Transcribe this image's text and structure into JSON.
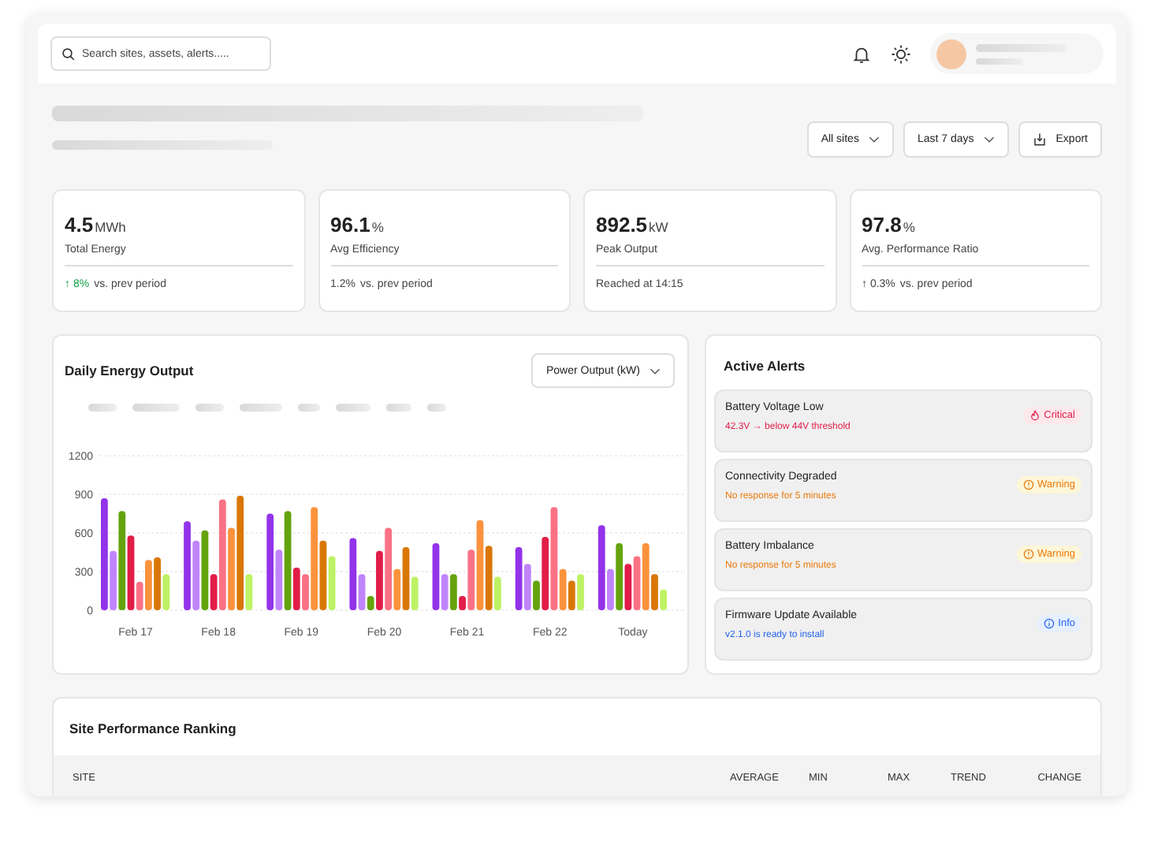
{
  "header": {
    "search": {
      "placeholder": "Search sites, assets, alerts....."
    }
  },
  "toolbar": {
    "filters": [
      {
        "label": "All sites"
      },
      {
        "label": "Last 7 days"
      }
    ],
    "export": "Export"
  },
  "kpis": [
    {
      "value": "4.5",
      "unit": "MWh",
      "label": "Total Energy",
      "delta": "↑ 8%",
      "highlight": true,
      "note": "vs. prev period"
    },
    {
      "value": "96.1",
      "unit": "%",
      "label": "Avg Efficiency",
      "delta": "1.2%",
      "highlight": false,
      "note": "vs. prev period"
    },
    {
      "value": "892.5",
      "unit": "kW",
      "label": "Peak Output",
      "note": "Reached at 14:15"
    },
    {
      "value": "97.8",
      "unit": "%",
      "label": "Avg. Performance Ratio",
      "delta": "↑ 0.3%",
      "highlight": false,
      "note": "vs. prev period"
    }
  ],
  "energy_chart": {
    "title": "Daily Energy Output",
    "metric": "Power Output (kW)",
    "chart_data": {
      "type": "bar",
      "categories": [
        "Feb 17",
        "Feb 18",
        "Feb 19",
        "Feb 20",
        "Feb 21",
        "Feb 22",
        "Today"
      ],
      "ylim": [
        0,
        1200
      ],
      "grid": true,
      "yticks": [
        0,
        300,
        600,
        900,
        1200
      ],
      "series": [
        {
          "color": "#9333ea",
          "values": [
            870,
            690,
            750,
            560,
            520,
            490,
            660
          ]
        },
        {
          "color": "#c084fc",
          "values": [
            460,
            540,
            470,
            280,
            280,
            360,
            320
          ]
        },
        {
          "color": "#65a30d",
          "values": [
            770,
            620,
            770,
            110,
            280,
            230,
            520
          ]
        },
        {
          "color": "#e11d48",
          "values": [
            580,
            280,
            330,
            460,
            110,
            570,
            360
          ]
        },
        {
          "color": "#fb7185",
          "values": [
            220,
            860,
            280,
            640,
            470,
            800,
            420
          ]
        },
        {
          "color": "#fb923c",
          "values": [
            390,
            640,
            800,
            320,
            700,
            320,
            520
          ]
        },
        {
          "color": "#d97706",
          "values": [
            410,
            890,
            540,
            490,
            500,
            230,
            280
          ]
        },
        {
          "color": "#bef264",
          "values": [
            280,
            280,
            420,
            260,
            260,
            280,
            160
          ]
        }
      ]
    }
  },
  "alerts": {
    "title": "Active Alerts",
    "items": [
      {
        "title": "Battery Voltage Low",
        "detail": "42.3V → below 44V threshold",
        "kind": "critical",
        "badge": "Critical"
      },
      {
        "title": "Connectivity Degraded",
        "detail": "No response for 5 minutes",
        "kind": "warning",
        "badge": "Warning"
      },
      {
        "title": "Battery Imbalance",
        "detail": "No response for 5 minutes",
        "kind": "warning",
        "badge": "Warning"
      },
      {
        "title": "Firmware Update Available",
        "detail": "v2.1.0 is ready to install",
        "kind": "info",
        "badge": "Info"
      }
    ]
  },
  "ranking": {
    "title": "Site Performance Ranking",
    "columns": [
      "SITE",
      "AVERAGE",
      "MIN",
      "MAX",
      "TREND",
      "CHANGE"
    ]
  }
}
